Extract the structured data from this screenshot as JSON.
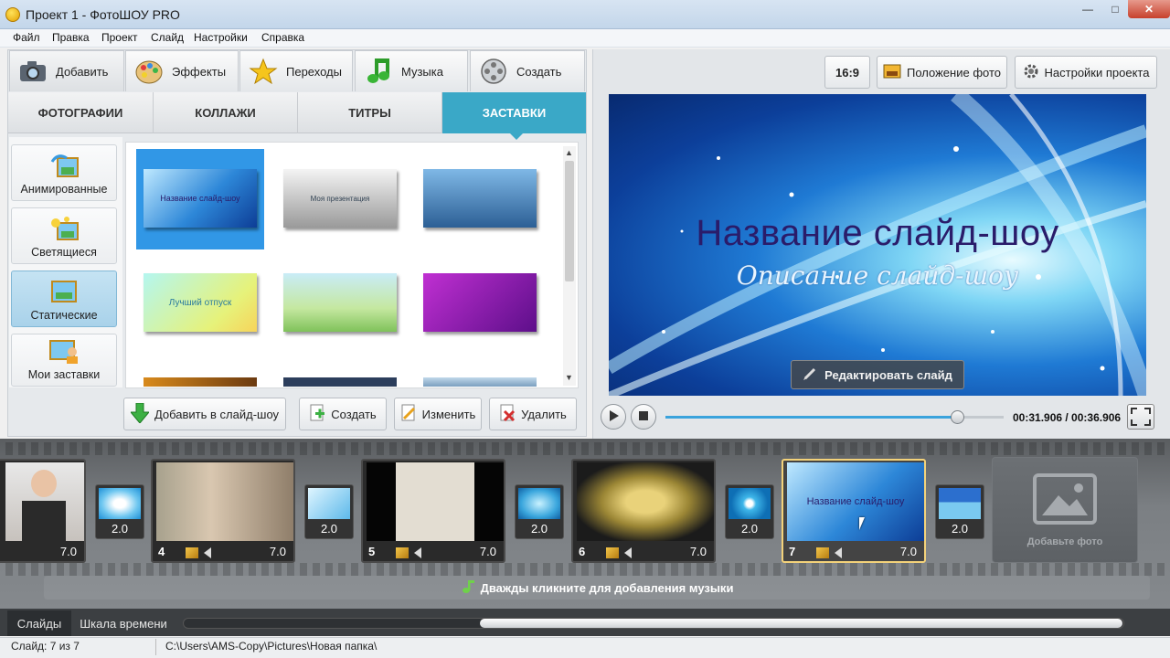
{
  "window": {
    "title": "Проект 1 - ФотоШОУ PRO",
    "minimize": "—",
    "maximize": "□",
    "close": "✕"
  },
  "menu": [
    "Файл",
    "Правка",
    "Проект",
    "Слайд",
    "Настройки",
    "Справка"
  ],
  "main_tabs": [
    "Добавить",
    "Эффекты",
    "Переходы",
    "Музыка",
    "Создать"
  ],
  "sub_tabs": [
    "ФОТОГРАФИИ",
    "КОЛЛАЖИ",
    "ТИТРЫ",
    "ЗАСТАВКИ"
  ],
  "categories": [
    "Анимированные",
    "Светящиеся",
    "Статические",
    "Мои заставки"
  ],
  "thumbs": [
    "Название слайд-шоу",
    "Моя презентация",
    "",
    "Лучший отпуск",
    "",
    ""
  ],
  "actions": [
    "Добавить в слайд-шоу",
    "Создать",
    "Изменить",
    "Удалить"
  ],
  "toolbar": {
    "ratio": "16:9",
    "photo_position": "Положение фото",
    "project_settings": "Настройки проекта"
  },
  "preview": {
    "title": "Название слайд-шоу",
    "subtitle": "Описание слайд-шоу",
    "edit_button": "Редактировать слайд",
    "time": "00:31.906 / 00:36.906",
    "progress": 0.865
  },
  "slides": [
    {
      "num": "",
      "dur": "7.0"
    },
    {
      "num": "4",
      "dur": "7.0"
    },
    {
      "num": "5",
      "dur": "7.0"
    },
    {
      "num": "6",
      "dur": "7.0"
    },
    {
      "num": "7",
      "dur": "7.0"
    }
  ],
  "slide7_caption": "Название слайд-шоу",
  "transitions": [
    "2.0",
    "2.0",
    "2.0",
    "2.0",
    "2.0"
  ],
  "add_photo": "Добавьте фото",
  "music_hint": "Дважды кликните для добавления музыки",
  "bottom_tabs": [
    "Слайды",
    "Шкала времени"
  ],
  "status": {
    "slide": "Слайд: 7 из 7",
    "path": "C:\\Users\\AMS-Copy\\Pictures\\Новая папка\\"
  }
}
